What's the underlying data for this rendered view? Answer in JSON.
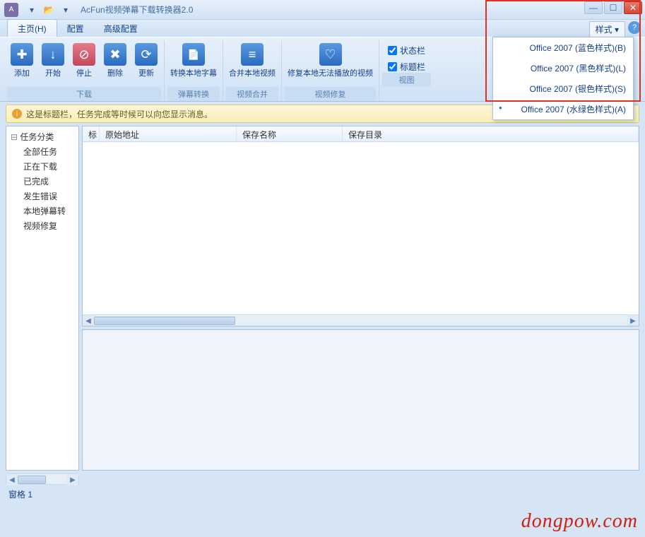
{
  "title": "AcFun视频弹幕下载转换器2.0",
  "menu": {
    "home": "主页(H)",
    "config": "配置",
    "advanced": "高级配置",
    "style": "样式"
  },
  "ribbon": {
    "download": {
      "add": "添加",
      "start": "开始",
      "stop": "停止",
      "delete": "删除",
      "refresh": "更新",
      "group": "下载"
    },
    "convert": {
      "convert": "转换本地字幕",
      "group": "弹幕转换"
    },
    "merge": {
      "merge": "合并本地视频",
      "group": "视频合并"
    },
    "fix": {
      "fix": "修复本地无法播放的视频",
      "group": "视频修复"
    },
    "view": {
      "status": "状态栏",
      "title": "标题栏",
      "group": "视图"
    }
  },
  "style_menu": {
    "blue": "Office 2007 (蓝色样式)(B)",
    "black": "Office 2007 (黑色样式)(L)",
    "silver": "Office 2007 (银色样式)(S)",
    "aqua": "Office 2007 (水绿色样式)(A)"
  },
  "infobar": "这是标题栏，任务完成等时候可以向您显示消息。",
  "tree": {
    "root": "任务分类",
    "items": [
      "全部任务",
      "正在下载",
      "已完成",
      "发生错误",
      "本地弹幕转",
      "视频修复"
    ]
  },
  "columns": {
    "flag": "标",
    "url": "原始地址",
    "name": "保存名称",
    "dir": "保存目录"
  },
  "status": "窗格 1",
  "watermark": "dongpow.com"
}
